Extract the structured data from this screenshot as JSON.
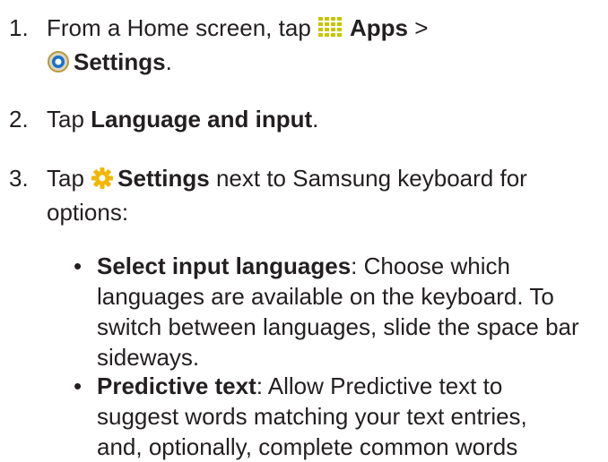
{
  "steps": [
    {
      "number": "1.",
      "prefix": "From a Home screen, tap",
      "apps_icon": "apps-grid-icon",
      "apps_label": "Apps",
      "separator": ">",
      "settings_icon": "settings-gear-icon",
      "settings_label": "Settings",
      "suffix": "."
    },
    {
      "number": "2.",
      "prefix": "Tap",
      "bold": "Language and input",
      "suffix": "."
    },
    {
      "number": "3.",
      "prefix": "Tap",
      "icon": "settings-cog-icon",
      "bold": "Settings",
      "line1_rest": "next to Samsung keyboard for",
      "line2": "options:"
    }
  ],
  "bullets": [
    {
      "symbol": "•",
      "title": "Select input languages",
      "lines": [
        ": Choose which",
        "languages are available on the keyboard. To",
        "switch between languages, slide the space bar",
        "sideways."
      ]
    },
    {
      "symbol": "•",
      "title": "Predictive text",
      "lines": [
        ": Allow Predictive text to",
        "suggest words matching your text entries,",
        "and, optionally, complete common words"
      ]
    }
  ],
  "colors": {
    "text": "#231f20",
    "apps_icon": "#c8c400",
    "settings_icon_ring": "#1a6fc9",
    "cog_icon": "#f2b705"
  }
}
